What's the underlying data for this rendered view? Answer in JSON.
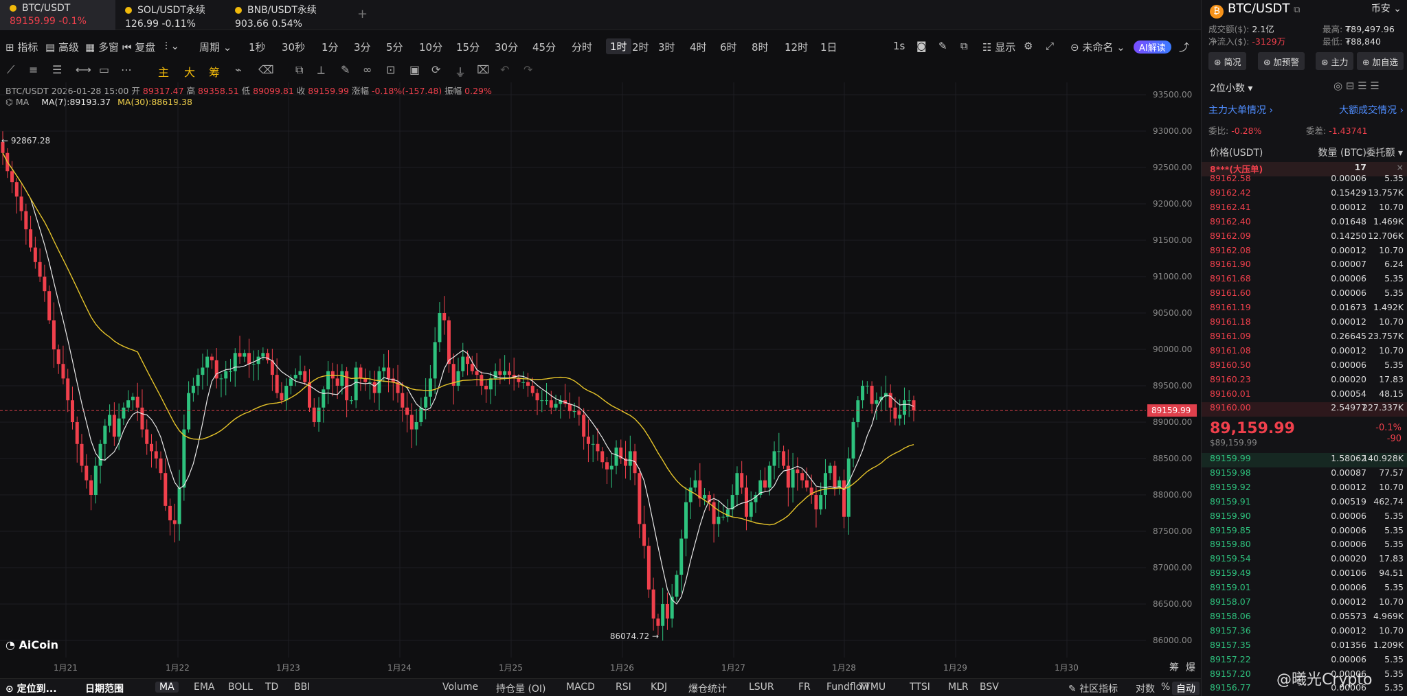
{
  "tabs": [
    {
      "symbol": "BTC/USDT",
      "price": "89159.99",
      "change": "-0.1%"
    },
    {
      "symbol": "SOL/USDT永续",
      "price": "126.99",
      "change": "-0.11%"
    },
    {
      "symbol": "BNB/USDT永续",
      "price": "903.66",
      "change": "0.54%"
    }
  ],
  "add_tab": "+",
  "toolbar1": {
    "indicators": "指标",
    "advanced": "高级",
    "multi_window": "多窗",
    "replay": "复盘",
    "period": "周期",
    "intervals": [
      "1秒",
      "30秒",
      "1分",
      "3分",
      "5分",
      "10分",
      "15分",
      "30分",
      "45分",
      "分时",
      "1时",
      "2时",
      "3时",
      "4时",
      "6时",
      "8时",
      "12时",
      "1日"
    ],
    "active_interval": "1时",
    "right_1s": "1s",
    "display": "显示",
    "unnamed": "未命名",
    "ai_label": "AI解读"
  },
  "toolbar2": {
    "main_label": "主",
    "big_label": "大",
    "chip_label": "筹"
  },
  "legend": {
    "line1_prefix": "BTC/USDT  2026-01-28 15:00",
    "open_label": "开",
    "open": "89317.47",
    "high_label": "高",
    "high": "89358.51",
    "low_label": "低",
    "low": "89099.81",
    "close_label": "收",
    "close": "89159.99",
    "change_label": "涨幅",
    "change": "-0.18%(-157.48)",
    "amp_label": "振幅",
    "amp": "0.29%",
    "ma_toggle": "MA",
    "ma7": "MA(7):89193.37",
    "ma30": "MA(30):88619.38"
  },
  "chart_data": {
    "type": "candlestick",
    "y_ticks": [
      "93500.00",
      "93000.00",
      "92500.00",
      "92000.00",
      "91500.00",
      "91000.00",
      "90500.00",
      "90000.00",
      "89500.00",
      "89000.00",
      "88500.00",
      "88000.00",
      "87500.00",
      "87000.00",
      "86500.00",
      "86000.00"
    ],
    "x_ticks": [
      "1月21",
      "1月22",
      "1月23",
      "1月24",
      "1月25",
      "1月26",
      "1月27",
      "1月28",
      "1月29",
      "1月30"
    ],
    "ylim": [
      86000,
      93500
    ],
    "current_price": "89159.99",
    "max_label": "92867.28",
    "min_label": "86074.72",
    "closes": [
      92700,
      92450,
      92300,
      92100,
      91900,
      91650,
      91400,
      91200,
      91000,
      90800,
      90400,
      90000,
      89800,
      89600,
      89300,
      89000,
      88700,
      88400,
      88200,
      88000,
      88400,
      88700,
      88950,
      89100,
      88800,
      89050,
      89200,
      89300,
      89350,
      89200,
      88900,
      88700,
      88600,
      88500,
      88300,
      87850,
      87650,
      87600,
      88100,
      88900,
      89400,
      89500,
      89650,
      89750,
      89900,
      89850,
      89600,
      89600,
      89700,
      89700,
      89950,
      89900,
      89950,
      89800,
      89800,
      89900,
      89950,
      89850,
      89650,
      89400,
      89300,
      89500,
      89600,
      89650,
      89700,
      89550,
      89200,
      89000,
      89200,
      89450,
      89700,
      89600,
      89500,
      89700,
      89300,
      89300,
      89750,
      89600,
      89550,
      89550,
      89400,
      89700,
      89750,
      89600,
      89550,
      89400,
      89200,
      89100,
      88900,
      89000,
      89200,
      89350,
      89600,
      90100,
      90500,
      90400,
      89800,
      89500,
      89700,
      89900,
      89800,
      89700,
      89650,
      89500,
      89450,
      89600,
      89700,
      89650,
      89700,
      89650,
      89600,
      89550,
      89550,
      89500,
      89400,
      89300,
      89300,
      89300,
      89200,
      89250,
      89300,
      89250,
      89150,
      89150,
      89100,
      88800,
      88700,
      88700,
      88600,
      88450,
      88350,
      88400,
      88650,
      88500,
      88400,
      88600,
      88300,
      87600,
      87300,
      86700,
      86300,
      86200,
      86500,
      86300,
      86600,
      86900,
      87400,
      87900,
      88100,
      88200,
      87950,
      88000,
      87900,
      87600,
      87700,
      87700,
      87800,
      88000,
      88300,
      88100,
      87700,
      87900,
      88000,
      88200,
      88100,
      88400,
      88600,
      88600,
      88400,
      88100,
      88350,
      88300,
      88200,
      88100,
      88000,
      87800,
      88000,
      88300,
      88400,
      88100,
      88200,
      87700,
      88500,
      89000,
      89300,
      89500,
      89500,
      89250,
      89300,
      89350,
      89400,
      89200,
      89050,
      89100,
      89300,
      89300,
      89160
    ],
    "ma7": [],
    "ma30": []
  },
  "bottombar": {
    "locate": "定位到...",
    "date_range": "日期范围",
    "overlays": [
      "MA",
      "EMA",
      "BOLL",
      "TD",
      "BBI"
    ],
    "active_overlay": "MA",
    "indicators": [
      "Volume",
      "持仓量 (OI)",
      "MACD",
      "RSI",
      "KDJ",
      "爆仓统计",
      "LSUR",
      "FR",
      "Fundflow",
      "TTMU",
      "TTSI",
      "MLR",
      "BSV"
    ],
    "community": "社区指标",
    "log": "对数",
    "pct": "%",
    "auto": "自动",
    "chip_mode": "筹",
    "burst": "爆"
  },
  "logo": "AiCoin",
  "right_panel": {
    "symbol": "BTC/USDT",
    "exchange": "币安",
    "vol_label": "成交额($):",
    "vol": "2.1亿",
    "netflow_label": "净流入($):",
    "netflow": "-3129万",
    "high_label": "最高:",
    "high": "₮89,497.96",
    "low_label": "最低:",
    "low": "₮88,840",
    "buttons": [
      "简况",
      "加预警",
      "主力",
      "加自选"
    ],
    "decimals": "2位小数",
    "main_link": "主力大单情况",
    "big_link": "大额成交情况",
    "ratio_label": "委比:",
    "ratio": "-0.28%",
    "diff_label": "委差:",
    "diff": "-1.43741",
    "headers": [
      "价格(USDT)",
      "数量 (BTC)",
      "委托额"
    ],
    "big_order_label": "8***(大压单)",
    "big_order_qty": "17",
    "asks": [
      [
        "89162.58",
        "0.00006",
        "5.35"
      ],
      [
        "89162.42",
        "0.15429",
        "13.757K"
      ],
      [
        "89162.41",
        "0.00012",
        "10.70"
      ],
      [
        "89162.40",
        "0.01648",
        "1.469K"
      ],
      [
        "89162.09",
        "0.14250",
        "12.706K"
      ],
      [
        "89162.08",
        "0.00012",
        "10.70"
      ],
      [
        "89161.90",
        "0.00007",
        "6.24"
      ],
      [
        "89161.68",
        "0.00006",
        "5.35"
      ],
      [
        "89161.60",
        "0.00006",
        "5.35"
      ],
      [
        "89161.19",
        "0.01673",
        "1.492K"
      ],
      [
        "89161.18",
        "0.00012",
        "10.70"
      ],
      [
        "89161.09",
        "0.26645",
        "23.757K"
      ],
      [
        "89161.08",
        "0.00012",
        "10.70"
      ],
      [
        "89160.50",
        "0.00006",
        "5.35"
      ],
      [
        "89160.23",
        "0.00020",
        "17.83"
      ],
      [
        "89160.01",
        "0.00054",
        "48.15"
      ],
      [
        "89160.00",
        "2.54977",
        "227.337K"
      ]
    ],
    "last_price": "89,159.99",
    "last_price_usd": "$89,159.99",
    "last_pct": "-0.1%",
    "last_chg": "-90",
    "bids": [
      [
        "89159.99",
        "1.58062",
        "140.928K"
      ],
      [
        "89159.98",
        "0.00087",
        "77.57"
      ],
      [
        "89159.92",
        "0.00012",
        "10.70"
      ],
      [
        "89159.91",
        "0.00519",
        "462.74"
      ],
      [
        "89159.90",
        "0.00006",
        "5.35"
      ],
      [
        "89159.85",
        "0.00006",
        "5.35"
      ],
      [
        "89159.80",
        "0.00006",
        "5.35"
      ],
      [
        "89159.54",
        "0.00020",
        "17.83"
      ],
      [
        "89159.49",
        "0.00106",
        "94.51"
      ],
      [
        "89159.01",
        "0.00006",
        "5.35"
      ],
      [
        "89158.07",
        "0.00012",
        "10.70"
      ],
      [
        "89158.06",
        "0.05573",
        "4.969K"
      ],
      [
        "89157.36",
        "0.00012",
        "10.70"
      ],
      [
        "89157.35",
        "0.01356",
        "1.209K"
      ],
      [
        "89157.22",
        "0.00006",
        "5.35"
      ],
      [
        "89157.20",
        "0.00006",
        "5.35"
      ],
      [
        "89156.77",
        "0.00006",
        "5.35"
      ]
    ]
  },
  "watermark": "@曦光Crypto"
}
